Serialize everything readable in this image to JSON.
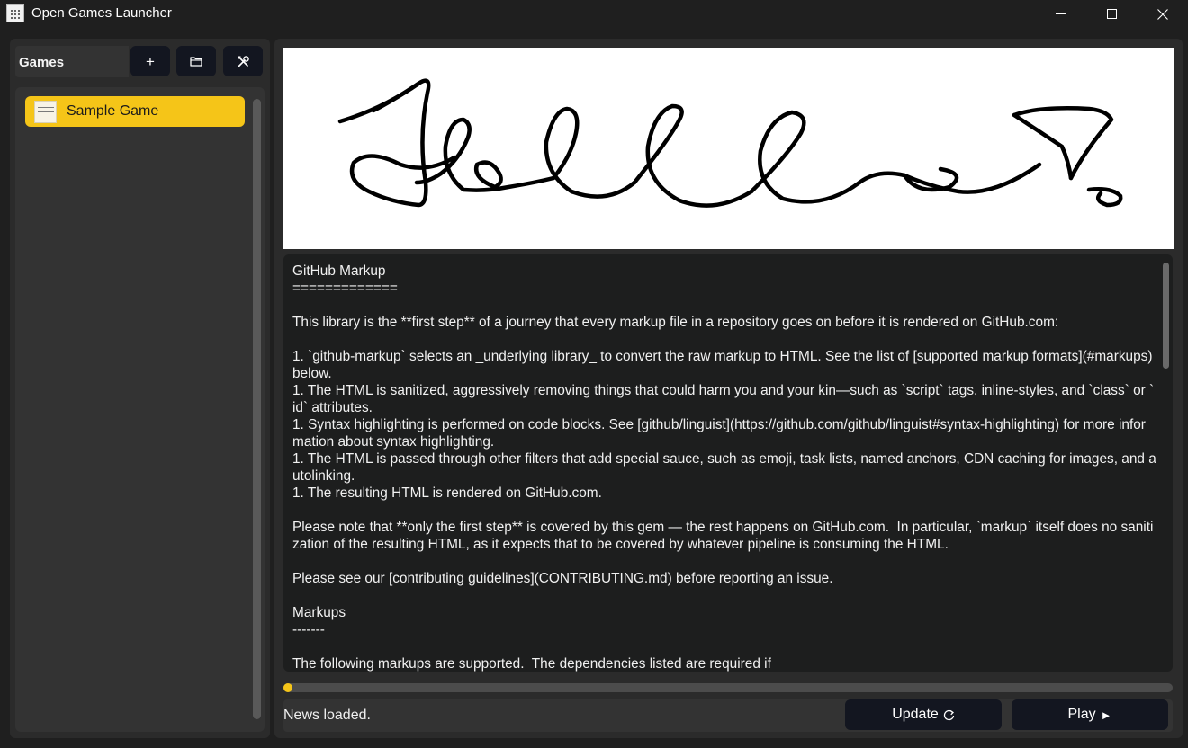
{
  "window": {
    "title": "Open Games Launcher"
  },
  "sidebar": {
    "header_label": "Games",
    "add_label": "+",
    "games": [
      {
        "name": "Sample Game",
        "selected": true
      }
    ]
  },
  "news": {
    "text": "GitHub Markup\n=============\n\nThis library is the **first step** of a journey that every markup file in a repository goes on before it is rendered on GitHub.com:\n\n1. `github-markup` selects an _underlying library_ to convert the raw markup to HTML. See the list of [supported markup formats](#markups) below.\n1. The HTML is sanitized, aggressively removing things that could harm you and your kin—such as `script` tags, inline-styles, and `class` or `id` attributes.\n1. Syntax highlighting is performed on code blocks. See [github/linguist](https://github.com/github/linguist#syntax-highlighting) for more information about syntax highlighting.\n1. The HTML is passed through other filters that add special sauce, such as emoji, task lists, named anchors, CDN caching for images, and autolinking.\n1. The resulting HTML is rendered on GitHub.com.\n\nPlease note that **only the first step** is covered by this gem — the rest happens on GitHub.com.  In particular, `markup` itself does no sanitization of the resulting HTML, as it expects that to be covered by whatever pipeline is consuming the HTML.\n\nPlease see our [contributing guidelines](CONTRIBUTING.md) before reporting an issue.\n\nMarkups\n-------\n\nThe following markups are supported.  The dependencies listed are required if"
  },
  "progress": {
    "fraction": 0.01
  },
  "status": {
    "text": "News loaded."
  },
  "actions": {
    "update_label": "Update",
    "play_label": "Play"
  },
  "icons": {
    "add": "plus-icon",
    "folder": "folder-icon",
    "tools": "tools-icon",
    "update": "refresh-icon",
    "play": "play-icon",
    "minimize": "minimize-icon",
    "maximize": "maximize-icon",
    "close": "close-icon"
  },
  "colors": {
    "accent": "#f5c518",
    "background": "#1f1f1f",
    "panel": "#2b2b2b",
    "button": "#131620"
  }
}
